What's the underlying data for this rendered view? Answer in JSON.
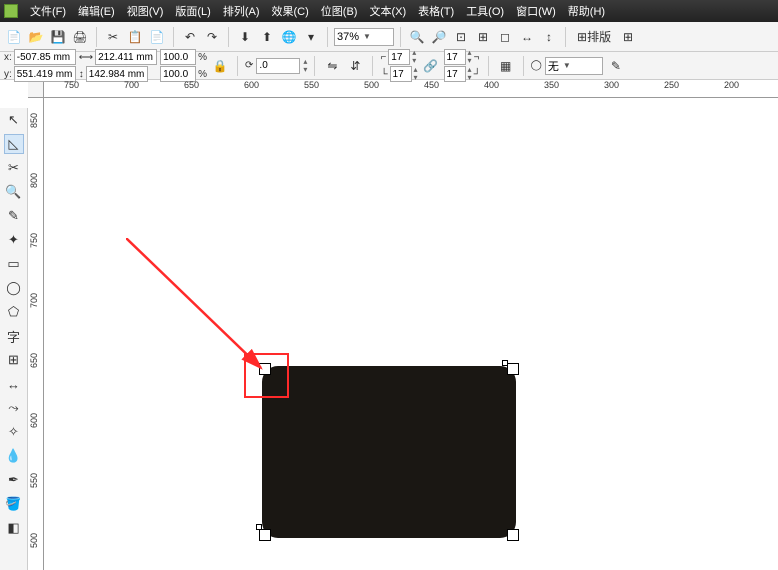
{
  "menu": {
    "items": [
      "文件(F)",
      "编辑(E)",
      "视图(V)",
      "版面(L)",
      "排列(A)",
      "效果(C)",
      "位图(B)",
      "文本(X)",
      "表格(T)",
      "工具(O)",
      "窗口(W)",
      "帮助(H)"
    ]
  },
  "zoom": "37%",
  "layout_btn": "排版",
  "coords": {
    "x_label": "x:",
    "x_val": "-507.85 mm",
    "y_label": "y:",
    "y_val": "551.419 mm",
    "w_val": "212.411 mm",
    "h_val": "142.984 mm",
    "sx_val": "100.0",
    "sy_val": "100.0",
    "pct": "%",
    "rot_val": ".0",
    "cell1": "17",
    "cell2": "17",
    "cell3": "17",
    "cell4": "17",
    "outline": "无"
  },
  "ruler_h": [
    "750",
    "700",
    "650",
    "600",
    "550",
    "500",
    "450",
    "400",
    "350",
    "300",
    "250",
    "200"
  ],
  "ruler_v": [
    "850",
    "800",
    "750",
    "700",
    "650",
    "600",
    "550",
    "500"
  ],
  "tools": [
    "pick",
    "shape",
    "crop",
    "zoom",
    "freehand",
    "smart",
    "rect",
    "ellipse",
    "polygon",
    "text",
    "table",
    "dimension",
    "connector",
    "effects",
    "eyedrop",
    "outline",
    "fill",
    "interactive"
  ]
}
